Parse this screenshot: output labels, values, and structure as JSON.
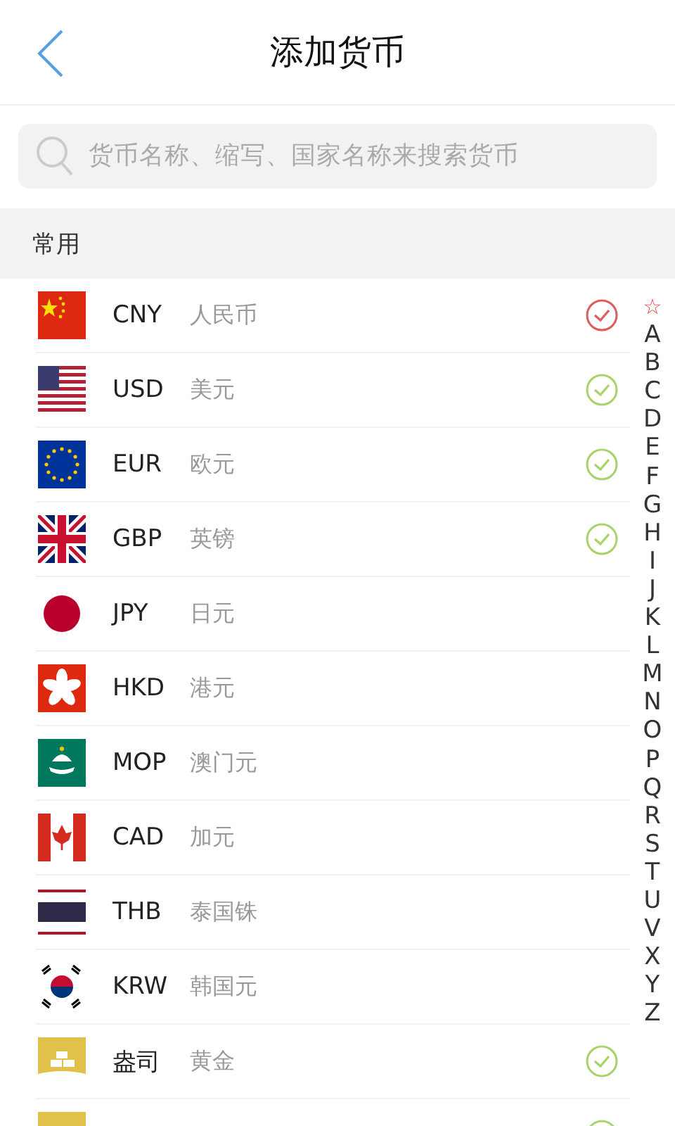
{
  "header": {
    "title": "添加货币"
  },
  "search": {
    "placeholder": "货币名称、缩写、国家名称来搜索货币"
  },
  "section": {
    "title": "常用"
  },
  "currencies": [
    {
      "kind": "cn",
      "code": "CNY",
      "name": "人民币",
      "checked": true,
      "base": true
    },
    {
      "kind": "us",
      "code": "USD",
      "name": "美元",
      "checked": true,
      "base": false
    },
    {
      "kind": "eu",
      "code": "EUR",
      "name": "欧元",
      "checked": true,
      "base": false
    },
    {
      "kind": "gb",
      "code": "GBP",
      "name": "英镑",
      "checked": true,
      "base": false
    },
    {
      "kind": "jp",
      "code": "JPY",
      "name": "日元",
      "checked": false
    },
    {
      "kind": "hk",
      "code": "HKD",
      "name": "港元",
      "checked": false
    },
    {
      "kind": "mo",
      "code": "MOP",
      "name": "澳门元",
      "checked": false
    },
    {
      "kind": "ca",
      "code": "CAD",
      "name": "加元",
      "checked": false
    },
    {
      "kind": "th",
      "code": "THB",
      "name": "泰国铢",
      "checked": false
    },
    {
      "kind": "kr",
      "code": "KRW",
      "name": "韩国元",
      "checked": false
    },
    {
      "kind": "gold",
      "code": "盎司",
      "name": "黄金",
      "checked": true,
      "base": false
    },
    {
      "kind": "gold",
      "checked": true,
      "base": false
    }
  ],
  "index": [
    {
      "label": "☆",
      "kind": "star"
    },
    {
      "label": "A",
      "kind": "letter"
    },
    {
      "label": "B",
      "kind": "letter"
    },
    {
      "label": "C",
      "kind": "letter"
    },
    {
      "label": "D",
      "kind": "letter"
    },
    {
      "label": "E",
      "kind": "letter"
    },
    {
      "label": "F",
      "kind": "letter"
    },
    {
      "label": "G",
      "kind": "letter"
    },
    {
      "label": "H",
      "kind": "letter"
    },
    {
      "label": "I",
      "kind": "letter"
    },
    {
      "label": "J",
      "kind": "letter"
    },
    {
      "label": "K",
      "kind": "letter"
    },
    {
      "label": "L",
      "kind": "letter"
    },
    {
      "label": "M",
      "kind": "letter"
    },
    {
      "label": "N",
      "kind": "letter"
    },
    {
      "label": "O",
      "kind": "letter"
    },
    {
      "label": "P",
      "kind": "letter"
    },
    {
      "label": "Q",
      "kind": "letter"
    },
    {
      "label": "R",
      "kind": "letter"
    },
    {
      "label": "S",
      "kind": "letter"
    },
    {
      "label": "T",
      "kind": "letter"
    },
    {
      "label": "U",
      "kind": "letter"
    },
    {
      "label": "V",
      "kind": "letter"
    },
    {
      "label": "X",
      "kind": "letter"
    },
    {
      "label": "Y",
      "kind": "letter"
    },
    {
      "label": "Z",
      "kind": "letter"
    }
  ]
}
